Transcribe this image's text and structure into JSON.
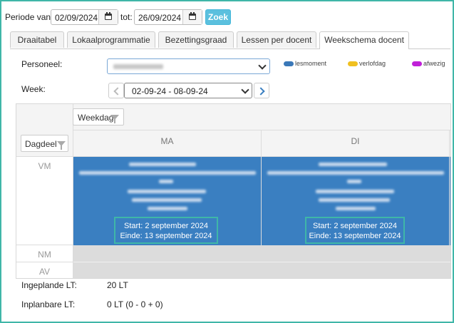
{
  "toolbar": {
    "periode_label": "Periode van:",
    "date_from": "02/09/2024",
    "tot_label": "tot:",
    "date_to": "26/09/2024",
    "zoek_label": "Zoek"
  },
  "tabs": [
    {
      "label": "Draaitabel",
      "active": false
    },
    {
      "label": "Lokaalprogrammatie",
      "active": false
    },
    {
      "label": "Bezettingsgraad",
      "active": false
    },
    {
      "label": "Lessen per docent",
      "active": false
    },
    {
      "label": "Weekschema docent",
      "active": true
    }
  ],
  "form": {
    "personeel_label": "Personeel:",
    "week_label": "Week:",
    "week_value": "02-09-24 - 08-09-24"
  },
  "legend": [
    {
      "label": "lesmoment",
      "color": "#3a78b8"
    },
    {
      "label": "verlofdag",
      "color": "#f0c020"
    },
    {
      "label": "afwezig",
      "color": "#c020d8"
    }
  ],
  "grid": {
    "weekdag_filter": "Weekdag",
    "dagdeel_filter": "Dagdeel",
    "days": [
      "MA",
      "DI"
    ],
    "rows": [
      "VM",
      "NM",
      "AV"
    ],
    "events": [
      {
        "start": "Start: 2 september 2024",
        "end": "Einde: 13 september 2024"
      },
      {
        "start": "Start: 2 september 2024",
        "end": "Einde: 13 september 2024"
      }
    ]
  },
  "summary": {
    "ingeplande_label": "Ingeplande LT:",
    "ingeplande_value": "20 LT",
    "inplanbare_label": "Inplanbare LT:",
    "inplanbare_value": "0 LT (0 - 0 + 0)"
  },
  "colors": {
    "accent": "#3fb6a8",
    "event": "#3a7fc1",
    "button": "#5bc0de"
  }
}
